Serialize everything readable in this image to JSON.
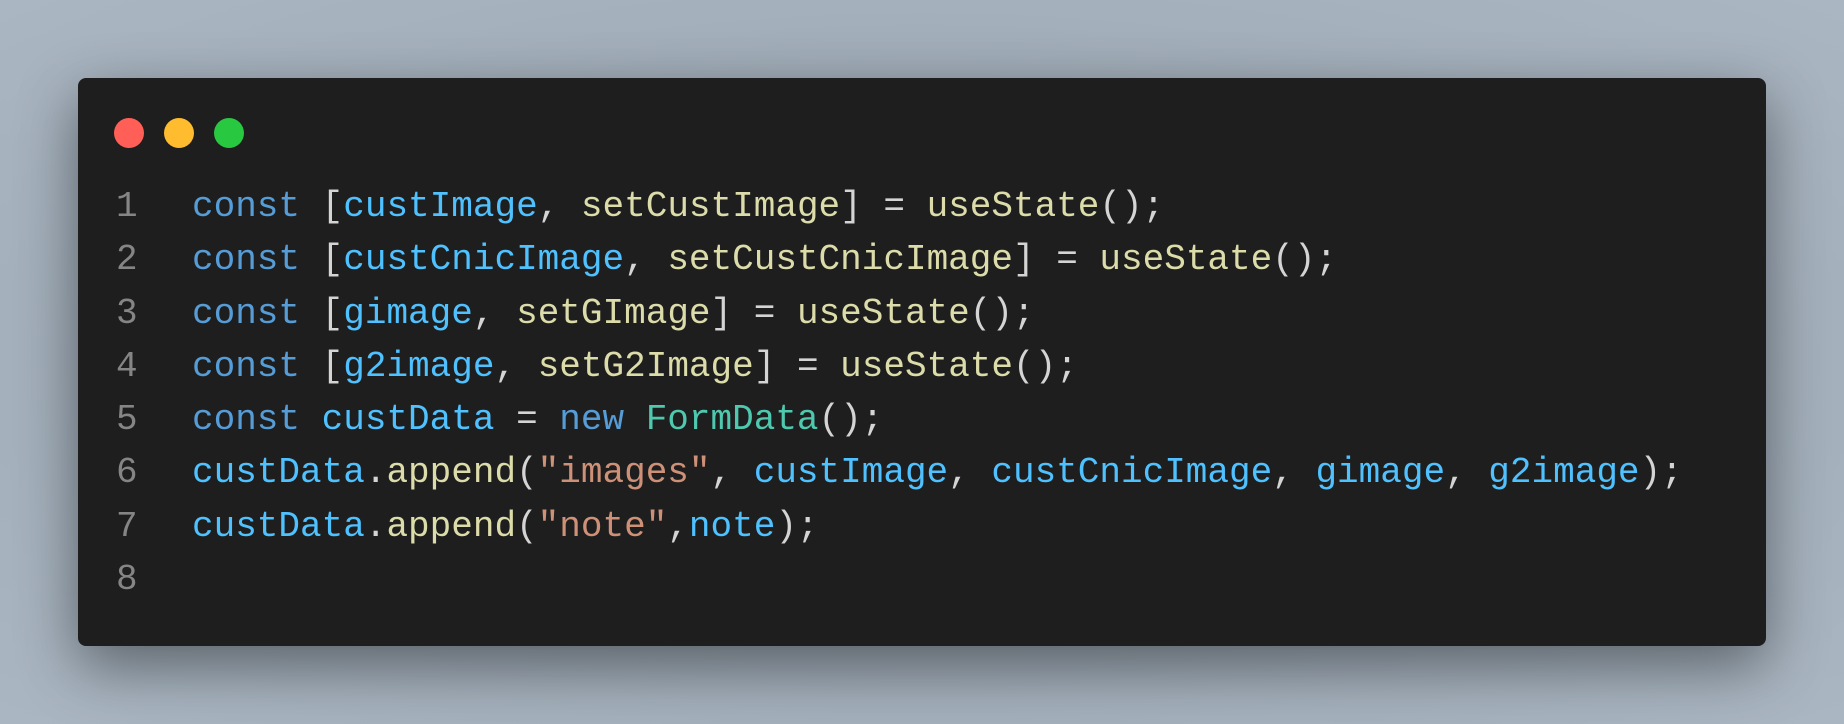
{
  "window_controls": {
    "close_color": "#ff5f57",
    "minimize_color": "#febc2e",
    "maximize_color": "#28c840"
  },
  "colors": {
    "background": "#1e1e1e",
    "keyword": "#569cd6",
    "variable": "#4fc1ff",
    "function": "#dcdcaa",
    "string": "#ce9178",
    "class": "#4ec9b0",
    "punctuation": "#d4d4d4",
    "line_number": "#858585"
  },
  "lines": [
    {
      "number": "1",
      "tokens": [
        [
          "kw",
          "const"
        ],
        [
          "pun",
          " ["
        ],
        [
          "var",
          "custImage"
        ],
        [
          "pun",
          ", "
        ],
        [
          "fn",
          "setCustImage"
        ],
        [
          "pun",
          "] = "
        ],
        [
          "fn",
          "useState"
        ],
        [
          "pun",
          "();"
        ]
      ]
    },
    {
      "number": "2",
      "tokens": [
        [
          "kw",
          "const"
        ],
        [
          "pun",
          " ["
        ],
        [
          "var",
          "custCnicImage"
        ],
        [
          "pun",
          ", "
        ],
        [
          "fn",
          "setCustCnicImage"
        ],
        [
          "pun",
          "] = "
        ],
        [
          "fn",
          "useState"
        ],
        [
          "pun",
          "();"
        ]
      ]
    },
    {
      "number": "3",
      "tokens": [
        [
          "kw",
          "const"
        ],
        [
          "pun",
          " ["
        ],
        [
          "var",
          "gimage"
        ],
        [
          "pun",
          ", "
        ],
        [
          "fn",
          "setGImage"
        ],
        [
          "pun",
          "] = "
        ],
        [
          "fn",
          "useState"
        ],
        [
          "pun",
          "();"
        ]
      ]
    },
    {
      "number": "4",
      "tokens": [
        [
          "kw",
          "const"
        ],
        [
          "pun",
          " ["
        ],
        [
          "var",
          "g2image"
        ],
        [
          "pun",
          ", "
        ],
        [
          "fn",
          "setG2Image"
        ],
        [
          "pun",
          "] = "
        ],
        [
          "fn",
          "useState"
        ],
        [
          "pun",
          "();"
        ]
      ]
    },
    {
      "number": "5",
      "tokens": [
        [
          "kw",
          "const"
        ],
        [
          "pun",
          " "
        ],
        [
          "var",
          "custData"
        ],
        [
          "pun",
          " = "
        ],
        [
          "kw",
          "new"
        ],
        [
          "pun",
          " "
        ],
        [
          "cls",
          "FormData"
        ],
        [
          "pun",
          "();"
        ]
      ]
    },
    {
      "number": "6",
      "tokens": [
        [
          "var",
          "custData"
        ],
        [
          "pun",
          "."
        ],
        [
          "fn",
          "append"
        ],
        [
          "pun",
          "("
        ],
        [
          "str",
          "\"images\""
        ],
        [
          "pun",
          ", "
        ],
        [
          "var",
          "custImage"
        ],
        [
          "pun",
          ", "
        ],
        [
          "var",
          "custCnicImage"
        ],
        [
          "pun",
          ", "
        ],
        [
          "var",
          "gimage"
        ],
        [
          "pun",
          ", "
        ],
        [
          "var",
          "g2image"
        ],
        [
          "pun",
          ");"
        ]
      ]
    },
    {
      "number": "7",
      "tokens": [
        [
          "var",
          "custData"
        ],
        [
          "pun",
          "."
        ],
        [
          "fn",
          "append"
        ],
        [
          "pun",
          "("
        ],
        [
          "str",
          "\"note\""
        ],
        [
          "pun",
          ","
        ],
        [
          "var",
          "note"
        ],
        [
          "pun",
          ");"
        ]
      ]
    },
    {
      "number": "8",
      "tokens": []
    }
  ]
}
